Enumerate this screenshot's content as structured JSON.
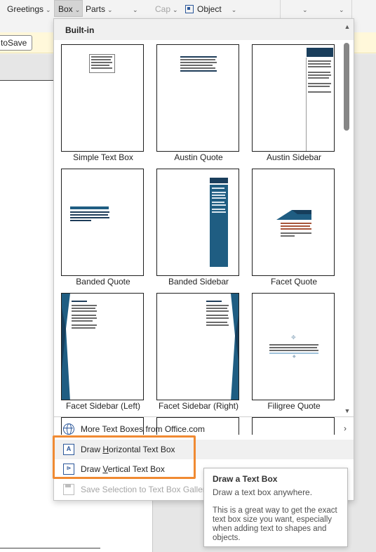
{
  "ribbon": {
    "greetings": "Greetings",
    "box": "Box",
    "parts": "Parts",
    "cap": "Cap",
    "object": "Object"
  },
  "infobar": {
    "autosave_label": "toSave"
  },
  "panel": {
    "section_header": "Built-in",
    "tiles": [
      {
        "label": "Simple Text Box"
      },
      {
        "label": "Austin Quote"
      },
      {
        "label": "Austin Sidebar"
      },
      {
        "label": "Banded Quote"
      },
      {
        "label": "Banded Sidebar"
      },
      {
        "label": "Facet Quote"
      },
      {
        "label": "Facet Sidebar (Left)"
      },
      {
        "label": "Facet Sidebar (Right)"
      },
      {
        "label": "Filigree Quote"
      }
    ],
    "menu": {
      "more_label": "More Text Boxes from Office.com",
      "draw_horizontal_pre": "Draw ",
      "draw_horizontal_acc": "H",
      "draw_horizontal_post": "orizontal Text Box",
      "draw_vertical_pre": "Draw ",
      "draw_vertical_acc": "V",
      "draw_vertical_post": "ertical Text Box",
      "save_selection_label": "Save Selection to Text Box Gallery"
    }
  },
  "tooltip": {
    "title": "Draw a Text Box",
    "subtitle": "Draw a text box anywhere.",
    "body": "This is a great way to get the exact text box size you want, especially when adding text to shapes and objects."
  },
  "colors": {
    "accent": "#2b579a",
    "highlight": "#f08a32",
    "infobar": "#fff8da"
  }
}
